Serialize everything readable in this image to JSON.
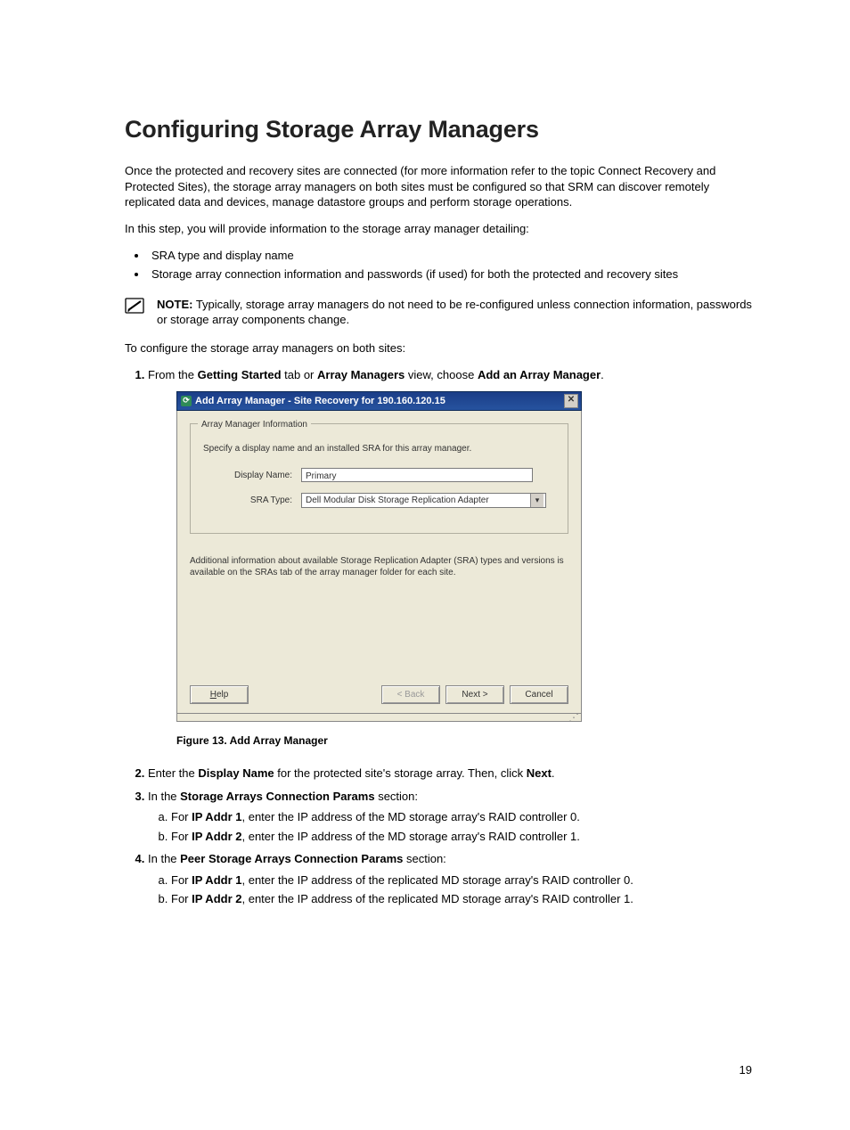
{
  "title": "Configuring Storage Array Managers",
  "intro1": "Once the protected and recovery sites are connected (for more information refer to the topic Connect Recovery and Protected Sites), the storage array managers on both sites must be configured so that SRM can discover remotely replicated data and devices, manage datastore groups and perform storage operations.",
  "intro2": "In this step, you will provide information to the storage array manager detailing:",
  "bullets": [
    "SRA type and display name",
    "Storage array connection information and passwords (if used) for both the protected and recovery sites"
  ],
  "note": {
    "label": "NOTE:",
    "text": " Typically, storage array managers do not need to be re-configured unless connection information, passwords or storage array components change."
  },
  "lead_in": "To configure the storage array managers on both sites:",
  "step1": {
    "pre": "From the ",
    "b1": "Getting Started",
    "mid1": " tab or ",
    "b2": "Array Managers",
    "mid2": " view, choose ",
    "b3": "Add an Array Manager",
    "post": "."
  },
  "dialog": {
    "title": "Add Array Manager - Site Recovery for 190.160.120.15",
    "close_glyph": "✕",
    "legend": "Array Manager Information",
    "desc": "Specify a display name and an installed SRA for this array manager.",
    "display_name_label": "Display Name:",
    "display_name_value": "Primary",
    "sra_type_label": "SRA Type:",
    "sra_type_value": "Dell Modular Disk Storage Replication Adapter",
    "additional": "Additional information about available Storage Replication Adapter (SRA) types and versions is available on the SRAs tab of the array manager folder for each site.",
    "help_label": "Help",
    "back_label": "< Back",
    "next_label": "Next >",
    "cancel_label": "Cancel"
  },
  "figure_caption": "Figure 13. Add Array Manager",
  "step2": {
    "pre": "Enter the ",
    "b1": "Display Name",
    "mid": " for the protected site's storage array. Then, click ",
    "b2": "Next",
    "post": "."
  },
  "step3": {
    "pre": "In the ",
    "b1": "Storage Arrays Connection Params",
    "post": " section:",
    "a": {
      "pre": "For ",
      "b": "IP Addr 1",
      "post": ", enter the IP address of the MD storage array's RAID controller 0."
    },
    "b": {
      "pre": "For ",
      "b": "IP Addr 2",
      "post": ", enter the IP address of the MD storage array's RAID controller 1."
    }
  },
  "step4": {
    "pre": "In the ",
    "b1": "Peer Storage Arrays Connection Params",
    "post": " section:",
    "a": {
      "pre": "For ",
      "b": "IP Addr 1",
      "post": ", enter the IP address of the replicated MD storage array's RAID controller 0."
    },
    "b": {
      "pre": "For ",
      "b": "IP Addr 2",
      "post": ", enter the IP address of the replicated MD storage array's RAID controller 1."
    }
  },
  "page_number": "19"
}
